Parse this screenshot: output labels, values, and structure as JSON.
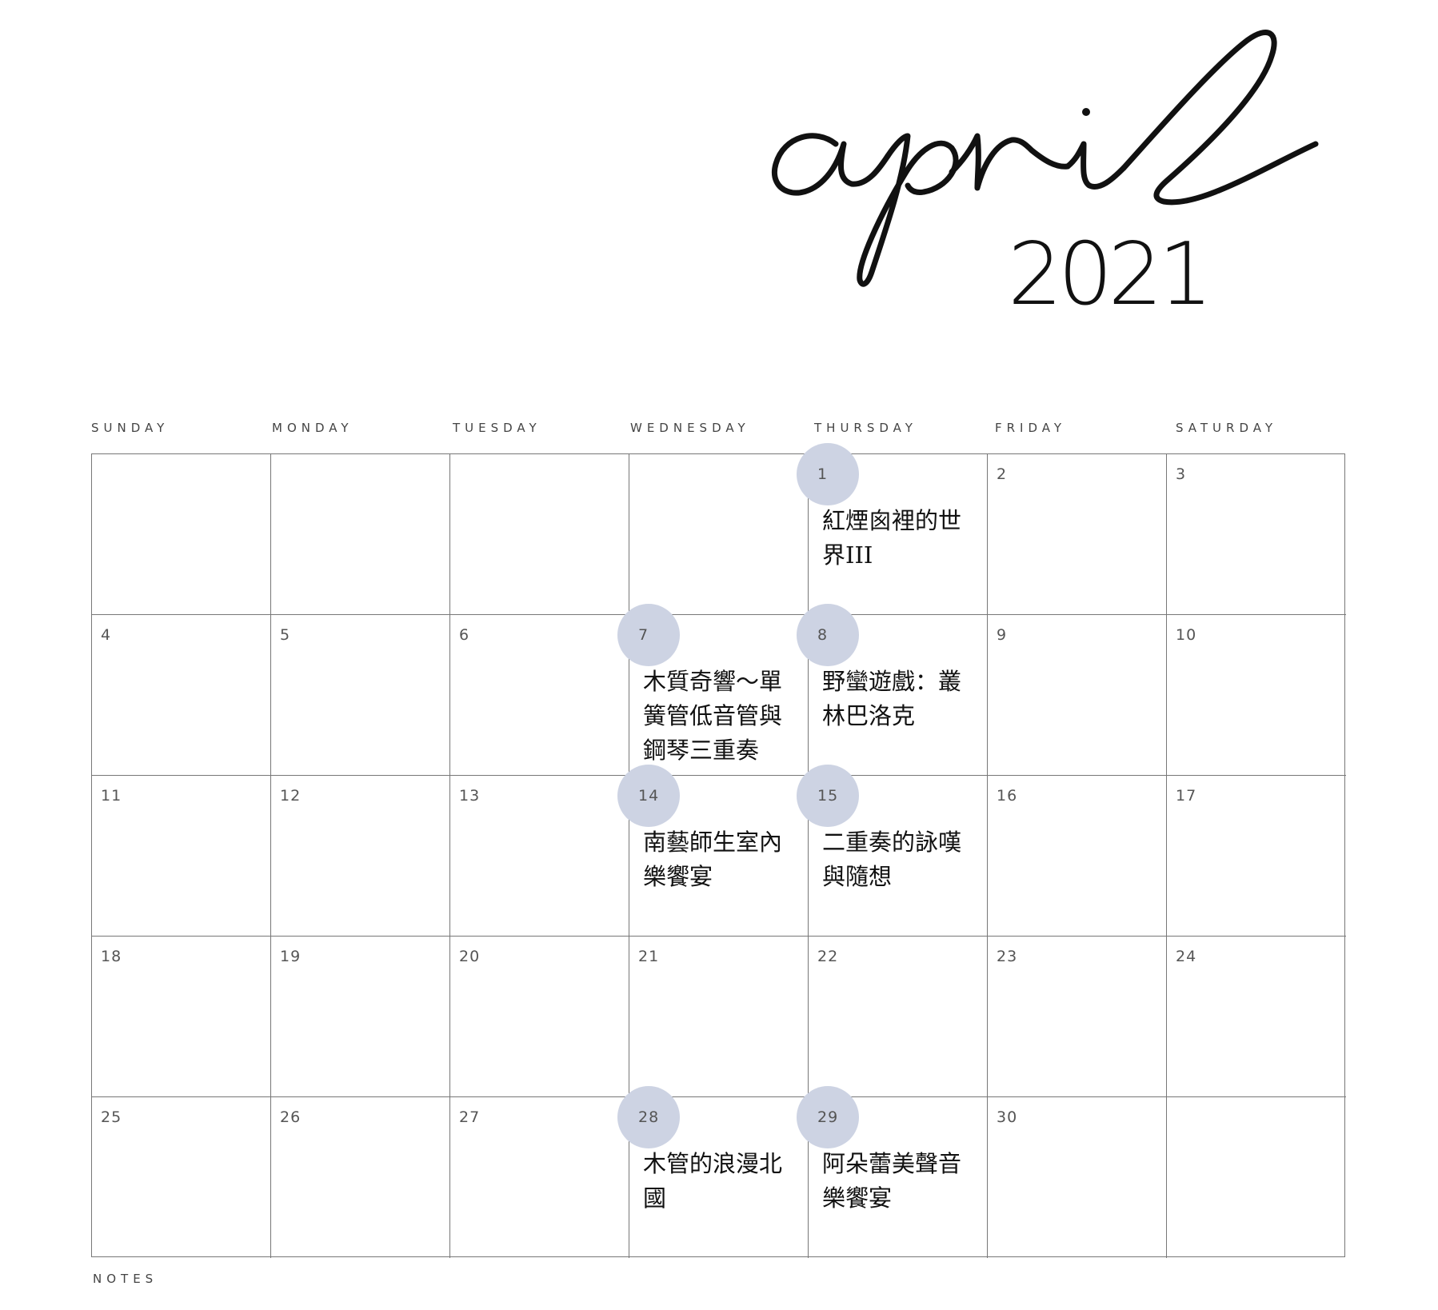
{
  "header": {
    "month": "april",
    "year": "2021"
  },
  "weekdays": [
    "SUNDAY",
    "MONDAY",
    "TUESDAY",
    "WEDNESDAY",
    "THURSDAY",
    "FRIDAY",
    "SATURDAY"
  ],
  "weeks": [
    [
      {
        "day": "",
        "event": "",
        "highlighted": false
      },
      {
        "day": "",
        "event": "",
        "highlighted": false
      },
      {
        "day": "",
        "event": "",
        "highlighted": false
      },
      {
        "day": "",
        "event": "",
        "highlighted": false
      },
      {
        "day": "1",
        "event": "紅煙囪裡的世界III",
        "highlighted": true
      },
      {
        "day": "2",
        "event": "",
        "highlighted": false
      },
      {
        "day": "3",
        "event": "",
        "highlighted": false
      }
    ],
    [
      {
        "day": "4",
        "event": "",
        "highlighted": false
      },
      {
        "day": "5",
        "event": "",
        "highlighted": false
      },
      {
        "day": "6",
        "event": "",
        "highlighted": false
      },
      {
        "day": "7",
        "event": "木質奇響～單簧管低音管與鋼琴三重奏",
        "highlighted": true
      },
      {
        "day": "8",
        "event": "野蠻遊戲：叢林巴洛克",
        "highlighted": true
      },
      {
        "day": "9",
        "event": "",
        "highlighted": false
      },
      {
        "day": "10",
        "event": "",
        "highlighted": false
      }
    ],
    [
      {
        "day": "11",
        "event": "",
        "highlighted": false
      },
      {
        "day": "12",
        "event": "",
        "highlighted": false
      },
      {
        "day": "13",
        "event": "",
        "highlighted": false
      },
      {
        "day": "14",
        "event": "南藝師生室內樂饗宴",
        "highlighted": true
      },
      {
        "day": "15",
        "event": "二重奏的詠嘆與隨想",
        "highlighted": true
      },
      {
        "day": "16",
        "event": "",
        "highlighted": false
      },
      {
        "day": "17",
        "event": "",
        "highlighted": false
      }
    ],
    [
      {
        "day": "18",
        "event": "",
        "highlighted": false
      },
      {
        "day": "19",
        "event": "",
        "highlighted": false
      },
      {
        "day": "20",
        "event": "",
        "highlighted": false
      },
      {
        "day": "21",
        "event": "",
        "highlighted": false
      },
      {
        "day": "22",
        "event": "",
        "highlighted": false
      },
      {
        "day": "23",
        "event": "",
        "highlighted": false
      },
      {
        "day": "24",
        "event": "",
        "highlighted": false
      }
    ],
    [
      {
        "day": "25",
        "event": "",
        "highlighted": false
      },
      {
        "day": "26",
        "event": "",
        "highlighted": false
      },
      {
        "day": "27",
        "event": "",
        "highlighted": false
      },
      {
        "day": "28",
        "event": "木管的浪漫北國",
        "highlighted": true
      },
      {
        "day": "29",
        "event": "阿朵蕾美聲音樂饗宴",
        "highlighted": true
      },
      {
        "day": "30",
        "event": "",
        "highlighted": false
      },
      {
        "day": "",
        "event": "",
        "highlighted": false
      }
    ]
  ],
  "footer": {
    "notes_label": "NOTES"
  },
  "colors": {
    "highlight": "#cdd3e3",
    "grid_line": "#777777"
  }
}
